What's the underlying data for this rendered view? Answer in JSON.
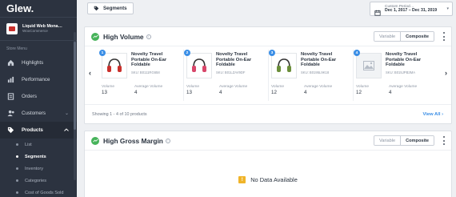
{
  "app": {
    "logo": "Glew."
  },
  "store": {
    "name": "Liquid Web Mona…",
    "platform": "WooCommerce"
  },
  "sidebar": {
    "section_title": "Store Menu",
    "items": [
      {
        "label": "Highlights",
        "icon": "home-icon"
      },
      {
        "label": "Performance",
        "icon": "chart-icon"
      },
      {
        "label": "Orders",
        "icon": "orders-icon"
      },
      {
        "label": "Customers",
        "icon": "customers-icon"
      },
      {
        "label": "Products",
        "icon": "tag-icon"
      }
    ],
    "chevron_symbol": "⌄",
    "sub_items": [
      "List",
      "Segments",
      "Inventory",
      "Categories",
      "Cost of Goods Sold"
    ]
  },
  "topbar": {
    "segments_label": "Segments",
    "period_label": "Custom Period…",
    "period_range": "Dec 1, 2017 – Dec 31, 2019",
    "caret": "▾"
  },
  "high_volume": {
    "title": "High Volume",
    "toggle": [
      "Variable",
      "Composite"
    ],
    "products": [
      {
        "rank": "1",
        "name": "Novelty Travel Portable On-Ear Foldable",
        "sku": "SKU: B0111RG658",
        "volume": "13",
        "avg_volume": "4"
      },
      {
        "rank": "2",
        "name": "Novelty Travel Portable On-Ear Foldable",
        "sku": "SKU: B01LZAV9DF",
        "volume": "13",
        "avg_volume": "4"
      },
      {
        "rank": "3",
        "name": "Novelty Travel Portable On-Ear Foldable",
        "sku": "SKU: B0195L9K18",
        "volume": "12",
        "avg_volume": "4"
      },
      {
        "rank": "4",
        "name": "Novelty Travel Portable On-Ear Foldable",
        "sku": "SKU: B015JPB3MA",
        "volume": "12",
        "avg_volume": "4"
      }
    ],
    "volume_label": "Volume",
    "avg_volume_label": "Average Volume",
    "showing": "Showing 1 - 4 of 10 products",
    "view_all": "View All ›",
    "prev_arrow": "‹",
    "next_arrow": "›",
    "info_glyph": "i"
  },
  "high_gross_margin": {
    "title": "High Gross Margin",
    "toggle": [
      "Variable",
      "Composite"
    ],
    "no_data": "No Data Available",
    "warn_glyph": "!"
  },
  "colors": {
    "sidebar_bg": "#2c3340",
    "accent_blue": "#3a8ee6",
    "trend_green": "#46b35a",
    "warn_yellow": "#f0b429"
  }
}
